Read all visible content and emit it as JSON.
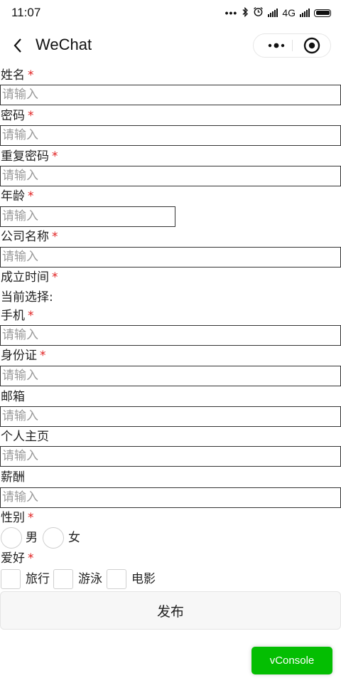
{
  "status_bar": {
    "time": "11:07",
    "network": "4G"
  },
  "nav": {
    "title": "WeChat"
  },
  "form": {
    "required_mark": "*",
    "placeholder": "请输入",
    "fields": {
      "name": "姓名",
      "password": "密码",
      "repeat_password": "重复密码",
      "age": "年龄",
      "company": "公司名称",
      "founded": "成立时间",
      "current_selection": "当前选择:",
      "phone": "手机",
      "id_card": "身份证",
      "email": "邮箱",
      "homepage": "个人主页",
      "salary": "薪酬",
      "gender": "性别",
      "hobby": "爱好"
    },
    "gender_options": [
      "男",
      "女"
    ],
    "hobby_options": [
      "旅行",
      "游泳",
      "电影"
    ],
    "submit_label": "发布"
  },
  "vconsole": {
    "label": "vConsole",
    "color": "#04be02"
  }
}
